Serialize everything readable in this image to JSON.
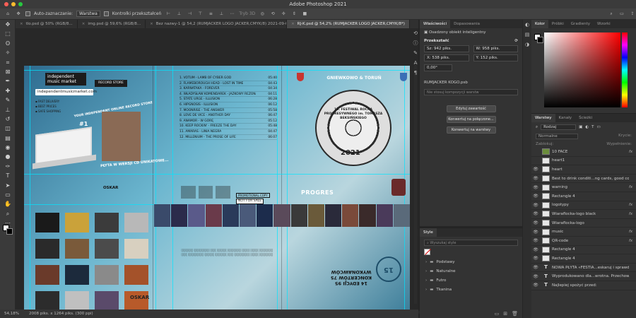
{
  "window": {
    "title": "Adobe Photoshop 2021",
    "traffic_colors": [
      "#ff5f57",
      "#febc2e",
      "#28c840"
    ]
  },
  "options": {
    "auto_select_label": "Auto-zaznaczanie:",
    "auto_select_value": "Warstwa",
    "transform_controls_label": "Kontrolki przekształceń",
    "mode_3d": "Tryb 3D"
  },
  "doc_tabs": [
    {
      "label": "tlo.psd @ 50% (RGB/8...",
      "active": false
    },
    {
      "label": "img.psd @ 59,6% (RGB/8...",
      "active": false
    },
    {
      "label": "Bez nazwy-1 @ 54,2 (RUMJACKER LOGO JACKER,CMYK/8) 2021-09-08 10-27-49,RGB/8#)...",
      "active": false
    },
    {
      "label": "RJ-K.psd @ 54,2% (RUMJACKER LOGO JACKER,CMYK/8*)",
      "active": true
    }
  ],
  "tools": [
    "move-icon",
    "marquee-icon",
    "lasso-icon",
    "quick-select-icon",
    "crop-icon",
    "frame-icon",
    "eyedropper-icon",
    "healing-icon",
    "brush-icon",
    "stamp-icon",
    "history-brush-icon",
    "eraser-icon",
    "gradient-icon",
    "blur-icon",
    "dodge-icon",
    "pen-icon",
    "type-icon",
    "path-select-icon",
    "rectangle-icon",
    "hand-icon",
    "zoom-icon",
    "more-icon"
  ],
  "artwork": {
    "logo": "independent music market",
    "url": "independentmusicmarket.com",
    "features": [
      "FAST DELIVERY",
      "BEST PRICES",
      "SAFE SHOPPING"
    ],
    "store_text": "YOUR INDEPENDENT ONLINE RECORD STORE",
    "hashtag": "#1",
    "store_badge": "RECORD STORE",
    "cd_promo": "PŁYTA W WERSJI CD UNIKATOWE...",
    "sponsor": "OSKAR",
    "tracks": [
      {
        "t": "1. VOTUM - LAMB OF CYBER GOD",
        "d": "05:40"
      },
      {
        "t": "2. FLAMEBOROUGH HEAD - LOST IN TIME",
        "d": "04:43"
      },
      {
        "t": "3. KARNATAKA - FOREVER",
        "d": "04:34"
      },
      {
        "t": "4. WŁADYSŁAW KOMENDAREK - JAZKOWY REZONANS",
        "d": "04:11"
      },
      {
        "t": "5. STATE URGE - ILLUSION",
        "d": "06:28"
      },
      {
        "t": "6. HIPGNOSIS - ILLUSION",
        "d": "06:12"
      },
      {
        "t": "7. MOONRISE - THE ANSWER",
        "d": "05:58"
      },
      {
        "t": "8. LOVE DE VICE - ANOTHER DAY",
        "d": "06:47"
      },
      {
        "t": "9. ANAMOR - W GÓRĘ",
        "d": "05:12"
      },
      {
        "t": "10. KEEP ROCKIN' - FREEZE THE DAY",
        "d": "05:48"
      },
      {
        "t": "11. AMARAS - LINIA NEGRA",
        "d": "04:47"
      },
      {
        "t": "12. MILLENIUM - THE PROSE OF LIFE",
        "d": "06:07"
      }
    ],
    "promo_copy": "PROMOTIONAL COPY",
    "not_for_sale": "NOT FOR SALE",
    "city": "GNIEWKOWO & TORUŃ",
    "vinyl_text": "15. FESTIWAL ROCKA PROGRESYWNEGO im. TOMASZA BEKSIŃSKIEGO",
    "year": "2021",
    "progres": "PROGRES",
    "oskar_back": "OSKAR",
    "upside_title": "14 EDYCJI 95 KONCERTÓW 75 WYKONAWCÓW",
    "seal": "15"
  },
  "thumb_colors": [
    "#1a1a1a",
    "#caa23a",
    "#3b3b3b",
    "#b8b8b8",
    "#2a2a2a",
    "#7a5a3a",
    "#4b4b4b",
    "#d8d0c0",
    "#6a3a2a",
    "#1c2a3c",
    "#8a8a8a",
    "#a4522a",
    "#2c2c2c",
    "#c0c0c0",
    "#5a4a6a",
    "#b85a2a"
  ],
  "strip_colors": [
    "#3a4a6a",
    "#2b2b4b",
    "#5a5a8a",
    "#6a3a4a",
    "#2a3a5a",
    "#4a5a7a",
    "#1c2c4c",
    "#5a4a5a",
    "#3a3a3a",
    "#6a5a3a",
    "#2a2a3a",
    "#7a4a3a",
    "#3a2a2a",
    "#4a3a5a",
    "#5a6a7a"
  ],
  "status": {
    "zoom": "54,18%",
    "size": "2008 piks. x 1264 piks. (300 ppi)"
  },
  "properties": {
    "tab_active": "Właściwości",
    "tab_other": "Dopasowania",
    "object_type": "Osadzony obiekt inteligentny",
    "transform": "Przekształć",
    "w_label": "Sz: 942 piks.",
    "h_label": "W: 958 piks.",
    "x_label": "X: 538 piks.",
    "y_label": "Y: 152 piks.",
    "angle": "0,00°",
    "file": "RUMJACKER KOGO.psb",
    "comp_placeholder": "Nie stosuj kompozycji warstw",
    "btn_edit": "Edytuj zawartość",
    "btn_convert_linked": "Konwertuj na połączone...",
    "btn_convert_layers": "Konwertuj na warstwy"
  },
  "styles": {
    "title": "Style",
    "search_placeholder": "Wyszukaj style",
    "folders": [
      "Podstawy",
      "Naturalne",
      "Futro",
      "Tkanina"
    ]
  },
  "color": {
    "tab_active": "Kolor",
    "tabs": [
      "Próbki",
      "Gradienty",
      "Wzorki"
    ]
  },
  "layers": {
    "tab_active": "Warstwy",
    "tabs": [
      "Kanały",
      "Ścieżki"
    ],
    "filter": "Rodzaj",
    "blend": "Normalne",
    "opacity_label": "Krycie:",
    "lock_label": "Zablokuj:",
    "fill_label": "Wypełnienie:",
    "items": [
      {
        "name": "10 FACE",
        "thumb": "green",
        "fx": true,
        "eye": false,
        "selected": false
      },
      {
        "name": "heart1",
        "thumb": "light",
        "fx": false,
        "eye": false,
        "selected": false
      },
      {
        "name": "heart",
        "thumb": "light",
        "fx": false,
        "eye": true,
        "selected": false
      },
      {
        "name": "Best to drink conditi...ng cards,  good comp",
        "thumb": "light",
        "fx": false,
        "eye": true,
        "selected": false
      },
      {
        "name": "warning",
        "thumb": "light",
        "fx": true,
        "eye": true,
        "selected": false
      },
      {
        "name": "Rectangle 4",
        "thumb": "light",
        "fx": false,
        "eye": true,
        "selected": false
      },
      {
        "name": "logotypy",
        "thumb": "light",
        "fx": true,
        "eye": true,
        "selected": false
      },
      {
        "name": "Wiaraflocka-logo black",
        "thumb": "light",
        "fx": true,
        "eye": true,
        "selected": false
      },
      {
        "name": "Wiaraflocka-logo",
        "thumb": "light",
        "fx": false,
        "eye": true,
        "selected": false
      },
      {
        "name": "music",
        "thumb": "light",
        "fx": true,
        "eye": true,
        "selected": false
      },
      {
        "name": "QR-code",
        "thumb": "light",
        "fx": true,
        "eye": true,
        "selected": false
      },
      {
        "name": "Rectangle 4",
        "thumb": "light",
        "fx": false,
        "eye": true,
        "selected": false
      },
      {
        "name": "Rectangle 4",
        "thumb": "light",
        "fx": false,
        "eye": true,
        "selected": false
      },
      {
        "name": "NOWA PŁYTA «FESTIA...eskaruj i sprawdź",
        "thumb": "type",
        "fx": false,
        "eye": true,
        "selected": false
      },
      {
        "name": "Wyprodukowano dla...wrotna. Przechowe",
        "thumb": "type",
        "fx": false,
        "eye": true,
        "selected": false
      },
      {
        "name": "Najlepiej spożyć przed:",
        "thumb": "type",
        "fx": false,
        "eye": true,
        "selected": false
      }
    ]
  }
}
